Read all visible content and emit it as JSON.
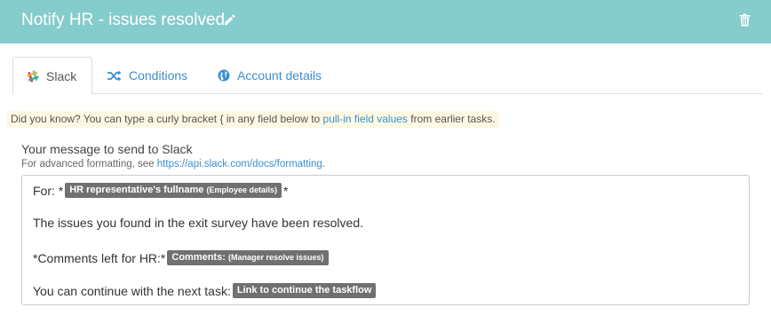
{
  "header": {
    "title": "Notify HR - issues resolved",
    "edit_icon": "pencil-icon",
    "delete_icon": "trash-icon",
    "color": "#85cccc"
  },
  "tabs": [
    {
      "label": "Slack",
      "icon": "slack-icon",
      "active": true
    },
    {
      "label": "Conditions",
      "icon": "shuffle-icon",
      "active": false
    },
    {
      "label": "Account details",
      "icon": "globe-icon",
      "active": false
    }
  ],
  "hint": {
    "prefix": "Did you know? You can type a curly bracket { in any field below to ",
    "link": "pull-in field values",
    "suffix": " from earlier tasks."
  },
  "message": {
    "label": "Your message to send to Slack",
    "sub_prefix": "For advanced formatting, see ",
    "sub_link": "https://api.slack.com/docs/formatting",
    "sub_suffix": ".",
    "line1_prefix": "For: *",
    "line1_pill": "HR representative's fullname",
    "line1_pill_sub": "(Employee details)",
    "line1_suffix": "*",
    "line2": "The issues you found in the exit survey have been resolved.",
    "line3_prefix": "*Comments left for HR:*",
    "line3_pill": "Comments:",
    "line3_pill_sub": "(Manager resolve issues)",
    "line4_prefix": "You can continue with the next task:",
    "line4_pill": "Link to continue the taskflow"
  }
}
